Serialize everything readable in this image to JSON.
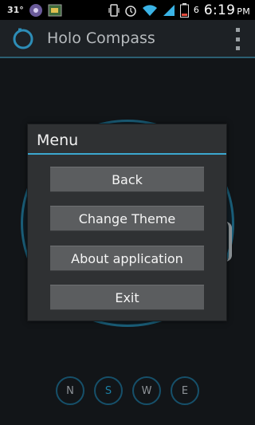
{
  "status_bar": {
    "temperature": "31°",
    "time": "6:19",
    "ampm": "PM",
    "battery_level": "6"
  },
  "action_bar": {
    "title": "Holo Compass"
  },
  "compass": {
    "directions": [
      "N",
      "S",
      "W",
      "E"
    ],
    "active_direction": "S"
  },
  "dialog": {
    "title": "Menu",
    "buttons": [
      "Back",
      "Change Theme",
      "About application",
      "Exit"
    ]
  },
  "colors": {
    "accent": "#3ca7cf",
    "ring": "#1a5e79"
  }
}
